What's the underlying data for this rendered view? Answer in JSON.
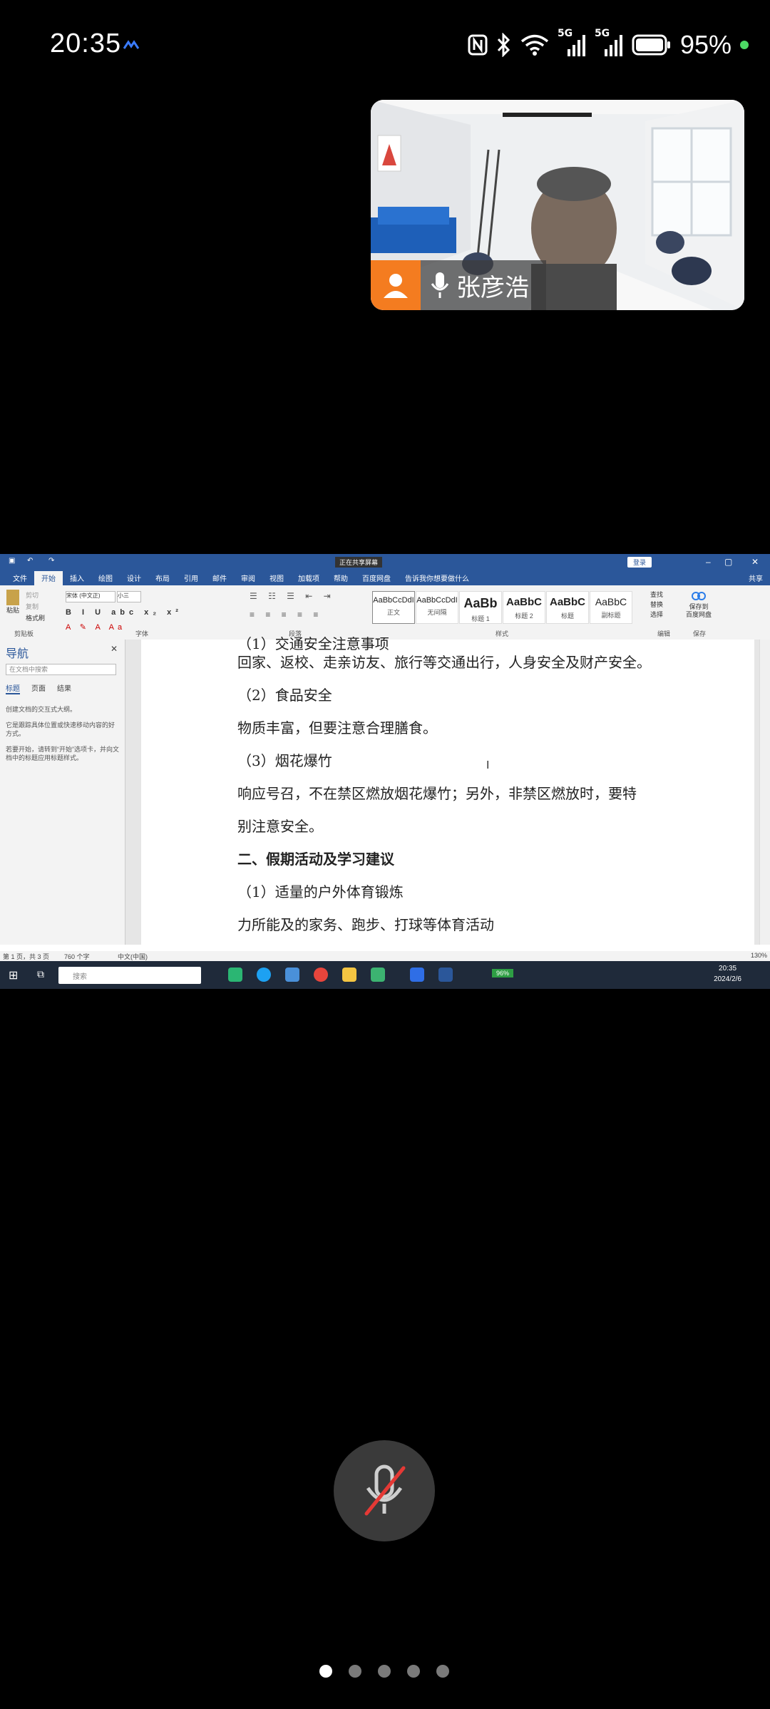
{
  "status_bar": {
    "time": "20:35",
    "battery_percent": "95%",
    "signal_labels": [
      "5G",
      "5G"
    ]
  },
  "video_tile": {
    "participant_name": "张彦浩"
  },
  "word": {
    "title": "正在共享屏幕",
    "login_label": "登录",
    "tabs": [
      "文件",
      "开始",
      "插入",
      "绘图",
      "设计",
      "布局",
      "引用",
      "邮件",
      "审阅",
      "视图",
      "加载项",
      "帮助",
      "百度网盘"
    ],
    "tell_me": "告诉我你想要做什么",
    "share_label": "共享",
    "clipboard": {
      "paste": "粘贴",
      "cut": "剪切",
      "copy": "复制",
      "format_painter": "格式刷",
      "group": "剪贴板"
    },
    "font": {
      "name": "宋体 (中文正)",
      "size": "小三",
      "group": "字体"
    },
    "paragraph_group": "段落",
    "styles": [
      {
        "sample": "AaBbCcDdI",
        "name": "正文"
      },
      {
        "sample": "AaBbCcDdI",
        "name": "无间隔"
      },
      {
        "sample": "AaBb",
        "name": "标题 1"
      },
      {
        "sample": "AaBbC",
        "name": "标题 2"
      },
      {
        "sample": "AaBbC",
        "name": "标题"
      },
      {
        "sample": "AaBbC",
        "name": "副标题"
      }
    ],
    "styles_group": "样式",
    "editing": {
      "find": "查找",
      "replace": "替换",
      "select": "选择",
      "group": "编辑"
    },
    "save_netdisk": {
      "line1": "保存到",
      "line2": "百度网盘",
      "group": "保存"
    },
    "nav": {
      "title": "导航",
      "search_placeholder": "在文档中搜索",
      "tabs": [
        "标题",
        "页面",
        "结果"
      ],
      "text1": "创建文档的交互式大纲。",
      "text2": "它是跟踪具体位置或快速移动内容的好方式。",
      "text3": "若要开始，请转到“开始”选项卡，并向文档中的标题应用标题样式。"
    },
    "document_lines": [
      "（1）交通安全注意事项",
      "回家、返校、走亲访友、旅行等交通出行，人身安全及财产安全。",
      "（2）食品安全",
      "物质丰富，但要注意合理膳食。",
      "（3）烟花爆竹",
      "响应号召，不在禁区燃放烟花爆竹；另外，非禁区燃放时，要特",
      "别注意安全。",
      "二、假期活动及学习建议",
      "（1）适量的户外体育锻炼",
      "力所能及的家务、跑步、打球等体育活动"
    ],
    "statusline": {
      "page": "第 1 页，共 3 页",
      "words": "760 个字",
      "language": "中文(中国)",
      "zoom": "130%"
    },
    "taskbar": {
      "search_placeholder": "搜索",
      "battery": "96%",
      "time": "20:35",
      "date": "2024/2/6"
    }
  },
  "bottom": {
    "page_dots_count": 5,
    "active_dot": 0
  }
}
